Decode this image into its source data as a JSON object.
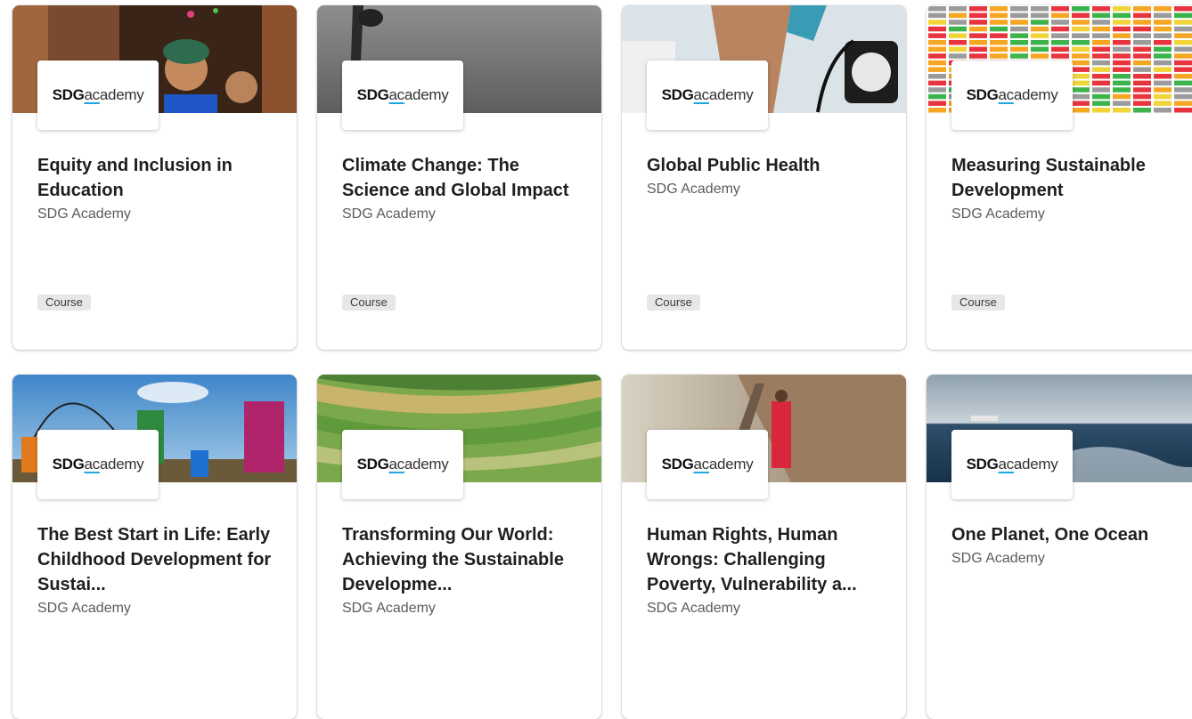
{
  "logo": {
    "sdg": "SDG",
    "ac": "ac",
    "rest": "ademy"
  },
  "cards": [
    {
      "title": "Equity and Inclusion in Education",
      "partner": "SDG Academy",
      "tag": "Course",
      "image": "children-in-doorway"
    },
    {
      "title": "Climate Change: The Science and Global Impact",
      "partner": "SDG Academy",
      "tag": "Course",
      "image": "grey-sky-microphone"
    },
    {
      "title": "Global Public Health",
      "partner": "SDG Academy",
      "tag": "Course",
      "image": "blood-pressure-check"
    },
    {
      "title": "Measuring Sustainable Development",
      "partner": "SDG Academy",
      "tag": "Course",
      "image": "colored-dashboard-grid"
    },
    {
      "title": "The Best Start in Life: Early Childhood Development for Sustai...",
      "partner": "SDG Academy",
      "image": "children-jump-rope"
    },
    {
      "title": "Transforming Our World: Achieving the Sustainable Developme...",
      "partner": "SDG Academy",
      "image": "rice-terraces"
    },
    {
      "title": "Human Rights, Human Wrongs: Challenging Poverty, Vulnerability a...",
      "partner": "SDG Academy",
      "image": "woman-on-wall-path"
    },
    {
      "title": "One Planet, One Ocean",
      "partner": "SDG Academy",
      "image": "ship-on-ocean"
    }
  ]
}
